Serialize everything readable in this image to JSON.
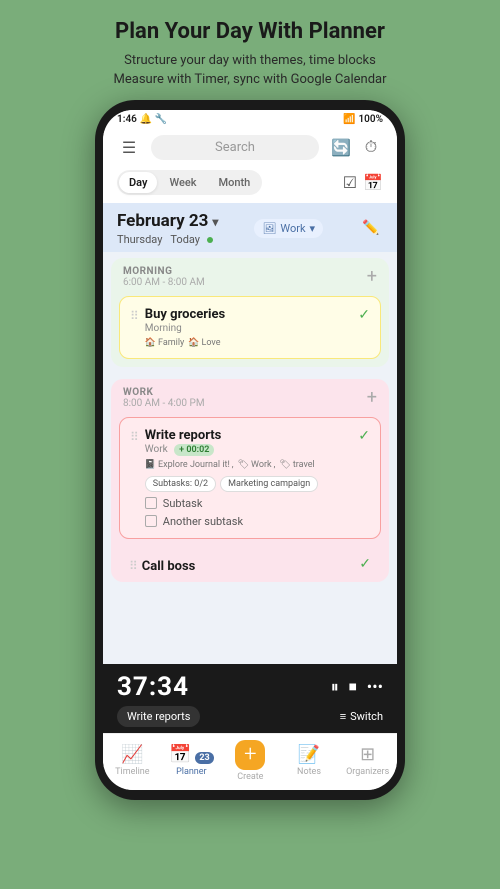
{
  "header": {
    "title": "Plan Your Day With Planner",
    "subtitle_line1": "Structure your day with themes, time blocks",
    "subtitle_line2": "Measure with Timer, sync with Google Calendar"
  },
  "status_bar": {
    "time": "1:46",
    "battery": "100%"
  },
  "search": {
    "placeholder": "Search"
  },
  "tabs": {
    "items": [
      {
        "label": "Day",
        "active": true
      },
      {
        "label": "Week",
        "active": false
      },
      {
        "label": "Month",
        "active": false
      }
    ]
  },
  "date": {
    "title": "February 23",
    "day": "Thursday",
    "today_label": "Today",
    "work_label": "Work"
  },
  "morning_section": {
    "title": "MORNING",
    "time_range": "6:00 AM - 8:00 AM",
    "task": {
      "title": "Buy groceries",
      "subtitle": "Morning",
      "tags": [
        "Family",
        "Love"
      ],
      "checked": true
    }
  },
  "work_section": {
    "title": "WORK",
    "time_range": "8:00 AM - 4:00 PM",
    "task1": {
      "title": "Write reports",
      "subtitle": "Work",
      "timer": "+ 00:02",
      "tags": [
        "Explore Journal it!",
        "Work",
        "travel"
      ],
      "badges": [
        "Subtasks: 0/2",
        "Marketing campaign"
      ],
      "subtasks": [
        "Subtask",
        "Another subtask"
      ],
      "checked": true
    },
    "task2": {
      "title": "Call boss"
    }
  },
  "timer": {
    "time": "37:34",
    "label": "Write reports",
    "switch_label": "Switch"
  },
  "bottom_nav": {
    "items": [
      {
        "icon": "📈",
        "label": "Timeline"
      },
      {
        "icon": "📅",
        "label": "Planner",
        "badge": "23",
        "active": true
      },
      {
        "icon": "+",
        "label": "Create"
      },
      {
        "icon": "📝",
        "label": "Notes"
      },
      {
        "icon": "⊞",
        "label": "Organizers"
      }
    ]
  }
}
